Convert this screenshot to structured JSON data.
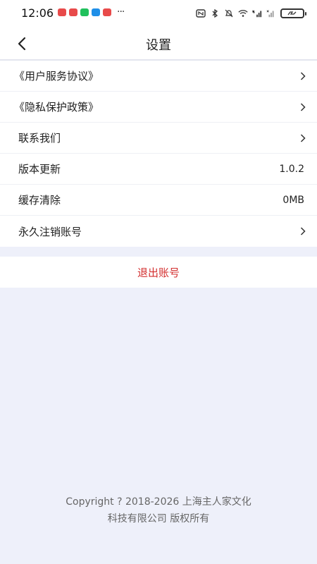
{
  "status_bar": {
    "time": "12:06",
    "more": "···",
    "notification_colors": [
      "#e84a4a",
      "#e84a4a",
      "#20c05c",
      "#1f8fe8",
      "#e84a4a"
    ]
  },
  "header": {
    "title": "设置",
    "back_icon": "chevron-left-icon"
  },
  "settings": [
    {
      "label": "《用户服务协议》",
      "value": "",
      "chevron": true
    },
    {
      "label": "《隐私保护政策》",
      "value": "",
      "chevron": true
    },
    {
      "label": "联系我们",
      "value": "",
      "chevron": true
    },
    {
      "label": "版本更新",
      "value": "1.0.2",
      "chevron": false
    },
    {
      "label": "缓存清除",
      "value": "0MB",
      "chevron": false
    },
    {
      "label": "永久注销账号",
      "value": "",
      "chevron": true
    }
  ],
  "logout": {
    "label": "退出账号",
    "color": "#d32f2f"
  },
  "footer": {
    "line1": "Copyright ? 2018-2026 上海主人家文化",
    "line2": "科技有限公司 版权所有"
  }
}
